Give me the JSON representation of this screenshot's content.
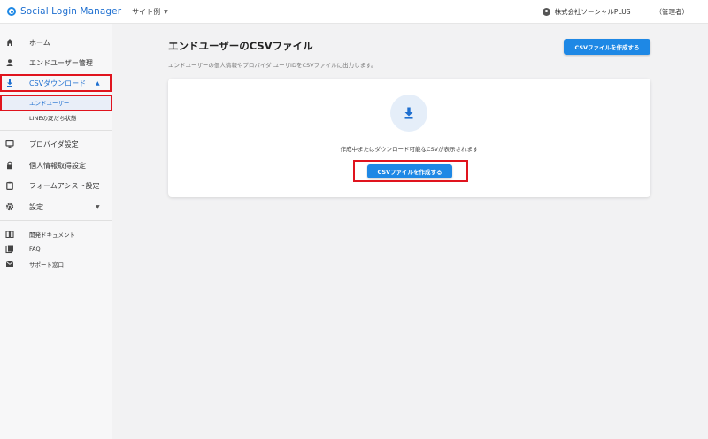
{
  "header": {
    "app_name": "Social Login Manager",
    "site_select": "サイト例",
    "account_name": "株式会社ソーシャルPLUS",
    "account_role": "（管理者）"
  },
  "sidebar": {
    "items": [
      {
        "label": "ホーム",
        "icon": "home-icon"
      },
      {
        "label": "エンドユーザー管理",
        "icon": "person-icon"
      },
      {
        "label": "CSVダウンロード",
        "icon": "download-icon",
        "active": true
      },
      {
        "label": "プロバイダ設定",
        "icon": "monitor-icon"
      },
      {
        "label": "個人情報取得設定",
        "icon": "lock-icon"
      },
      {
        "label": "フォームアシスト設定",
        "icon": "clipboard-icon"
      },
      {
        "label": "設定",
        "icon": "gear-icon"
      }
    ],
    "sub_items": [
      {
        "label": "エンドユーザー",
        "active": true
      },
      {
        "label": "LINEの友だち状態"
      }
    ],
    "secondary": [
      {
        "label": "開発ドキュメント",
        "icon": "book-icon"
      },
      {
        "label": "FAQ",
        "icon": "faq-icon"
      },
      {
        "label": "サポート窓口",
        "icon": "mail-icon"
      }
    ]
  },
  "main": {
    "title": "エンドユーザーのCSVファイル",
    "description": "エンドユーザーの個人情報やプロバイダ ユーザIDをCSVファイルに出力します。",
    "create_button": "CSVファイルを作成する",
    "empty_message": "作成中またはダウンロード可能なCSVが表示されます",
    "card_button": "CSVファイルを作成する"
  },
  "colors": {
    "accent": "#1e88e5",
    "link": "#1e6fd0",
    "highlight": "#e0141e"
  }
}
